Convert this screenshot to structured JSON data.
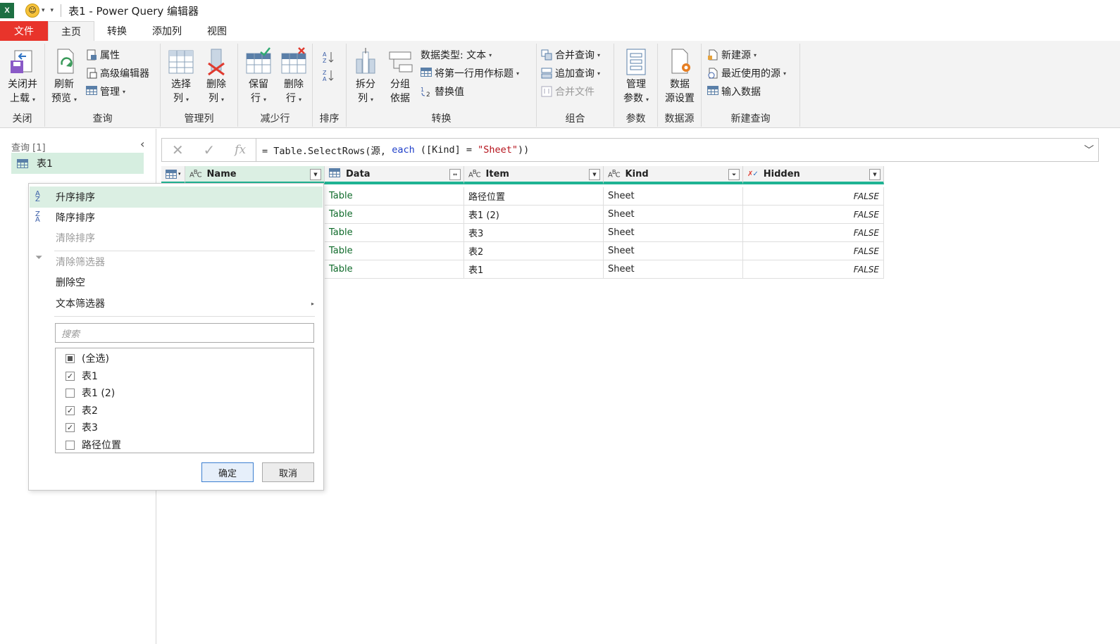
{
  "title_bar": {
    "app_icon": "X",
    "title": "表1 - Power Query 编辑器"
  },
  "menu_tabs": [
    {
      "label": "文件"
    },
    {
      "label": "主页"
    },
    {
      "label": "转换"
    },
    {
      "label": "添加列"
    },
    {
      "label": "视图"
    }
  ],
  "ribbon": {
    "close_load": {
      "line1": "关闭并",
      "line2": "上载"
    },
    "refresh": {
      "line1": "刷新",
      "line2": "预览"
    },
    "properties": "属性",
    "advanced_editor": "高级编辑器",
    "manage": "管理",
    "choose_cols": {
      "line1": "选择",
      "line2": "列"
    },
    "remove_cols": {
      "line1": "删除",
      "line2": "列"
    },
    "keep_rows": {
      "line1": "保留",
      "line2": "行"
    },
    "remove_rows": {
      "line1": "删除",
      "line2": "行"
    },
    "split_col": {
      "line1": "拆分",
      "line2": "列"
    },
    "group_by": {
      "line1": "分组",
      "line2": "依据"
    },
    "data_type": "数据类型: 文本",
    "first_row_header": "将第一行用作标题",
    "replace_values": "替换值",
    "merge_queries": "合并查询",
    "append_queries": "追加查询",
    "combine_files": "合并文件",
    "manage_params": {
      "line1": "管理",
      "line2": "参数"
    },
    "data_source_settings": {
      "line1": "数据",
      "line2": "源设置"
    },
    "new_source": "新建源",
    "recent_sources": "最近使用的源",
    "enter_data": "输入数据",
    "groups": {
      "close": "关闭",
      "query": "查询",
      "manage_cols": "管理列",
      "reduce_rows": "减少行",
      "sort": "排序",
      "transform": "转换",
      "combine": "组合",
      "params": "参数",
      "data_source": "数据源",
      "new_query": "新建查询"
    }
  },
  "queries_pane": {
    "header": "查询 [1]",
    "items": [
      {
        "label": "表1"
      }
    ]
  },
  "formula_bar": {
    "prefix": "= Table.SelectRows(源, ",
    "keyword": "each",
    "mid": " ([Kind] = ",
    "string": "\"Sheet\"",
    "suffix": "))"
  },
  "table": {
    "columns": [
      {
        "name": "Name",
        "type": "ABC"
      },
      {
        "name": "Data",
        "type": "table"
      },
      {
        "name": "Item",
        "type": "ABC"
      },
      {
        "name": "Kind",
        "type": "ABC"
      },
      {
        "name": "Hidden",
        "type": "bool"
      }
    ],
    "rows": [
      {
        "data": "Table",
        "item": "路径位置",
        "kind": "Sheet",
        "hidden": "FALSE"
      },
      {
        "data": "Table",
        "item": "表1 (2)",
        "kind": "Sheet",
        "hidden": "FALSE"
      },
      {
        "data": "Table",
        "item": "表3",
        "kind": "Sheet",
        "hidden": "FALSE"
      },
      {
        "data": "Table",
        "item": "表2",
        "kind": "Sheet",
        "hidden": "FALSE"
      },
      {
        "data": "Table",
        "item": "表1",
        "kind": "Sheet",
        "hidden": "FALSE"
      }
    ]
  },
  "filter_menu": {
    "sort_asc": "升序排序",
    "sort_desc": "降序排序",
    "clear_sort": "清除排序",
    "clear_filter": "清除筛选器",
    "remove_empty": "删除空",
    "text_filters": "文本筛选器",
    "search_placeholder": "搜索",
    "options": [
      {
        "label": "(全选)",
        "state": "partial"
      },
      {
        "label": "表1",
        "state": "checked"
      },
      {
        "label": "表1 (2)",
        "state": "unchecked"
      },
      {
        "label": "表2",
        "state": "checked"
      },
      {
        "label": "表3",
        "state": "checked"
      },
      {
        "label": "路径位置",
        "state": "unchecked"
      }
    ],
    "ok": "确定",
    "cancel": "取消"
  },
  "colors": {
    "file_tab": "#e8342b",
    "header_accent": "#1fb393",
    "selected_query": "#d6eee0",
    "link_green": "#106b2b"
  }
}
